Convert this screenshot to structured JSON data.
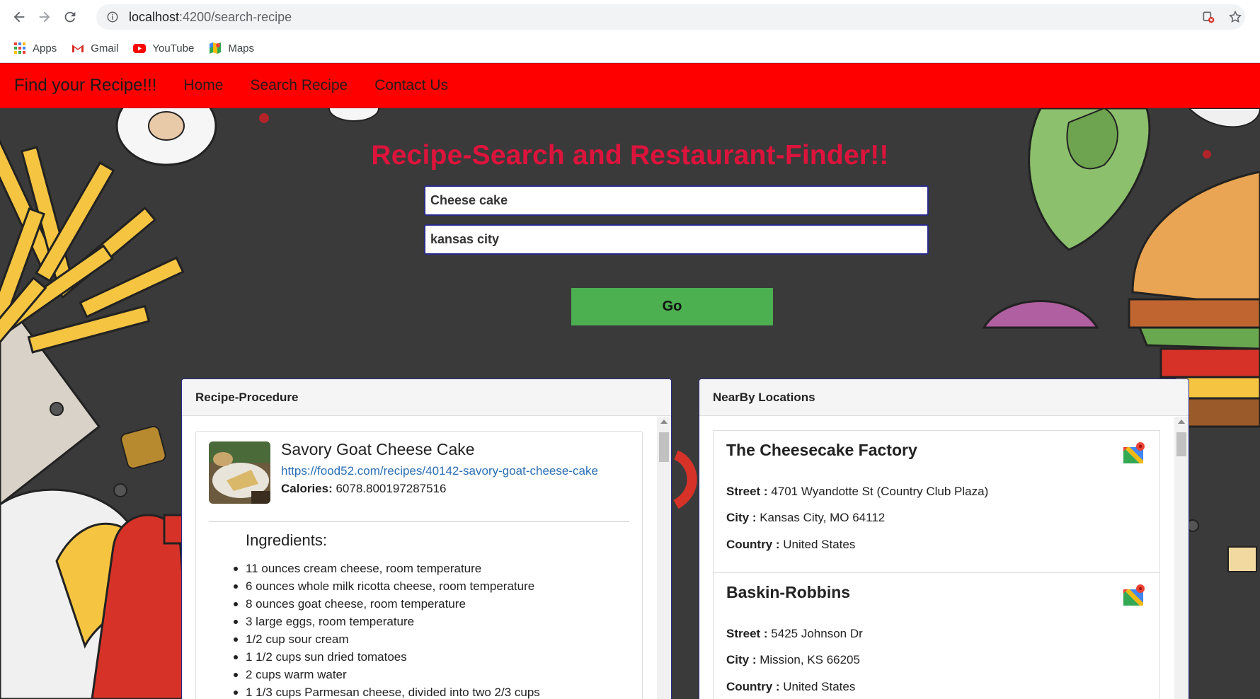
{
  "browser": {
    "url_host": "localhost",
    "url_path": ":4200/search-recipe",
    "bookmarks": [
      {
        "label": "Apps",
        "icon": "apps-grid-icon"
      },
      {
        "label": "Gmail",
        "icon": "gmail-icon"
      },
      {
        "label": "YouTube",
        "icon": "youtube-icon"
      },
      {
        "label": "Maps",
        "icon": "maps-icon"
      }
    ]
  },
  "app": {
    "brand": "Find your Recipe!!!",
    "nav": [
      "Home",
      "Search Recipe",
      "Contact Us"
    ],
    "title": "Recipe-Search and Restaurant-Finder!!",
    "recipe_query": "Cheese cake",
    "location_query": "kansas city",
    "go_label": "Go",
    "accent_color": "#ff0000",
    "title_color": "#dc143c",
    "button_color": "#4caf50"
  },
  "recipe_panel": {
    "header": "Recipe-Procedure",
    "recipe": {
      "title": "Savory Goat Cheese Cake",
      "link": "https://food52.com/recipes/40142-savory-goat-cheese-cake",
      "calories_label": "Calories:",
      "calories_value": " 6078.800197287516",
      "ingredients_heading": "Ingredients:",
      "ingredients": [
        "11 ounces cream cheese, room temperature",
        "6 ounces whole milk ricotta cheese, room temperature",
        "8 ounces goat cheese, room temperature",
        "3 large eggs, room temperature",
        "1/2 cup sour cream",
        "1 1/2 cups sun dried tomatoes",
        "2 cups warm water",
        "1 1/3 cups Parmesan cheese, divided into two 2/3 cups"
      ]
    }
  },
  "locations_panel": {
    "header": "NearBy Locations",
    "street_label": "Street :",
    "city_label": "City :",
    "country_label": "Country :",
    "locations": [
      {
        "name": "The Cheesecake Factory",
        "street": " 4701 Wyandotte St (Country Club Plaza)",
        "city": " Kansas City, MO 64112",
        "country": " United States"
      },
      {
        "name": "Baskin-Robbins",
        "street": " 5425 Johnson Dr",
        "city": " Mission, KS 66205",
        "country": " United States"
      }
    ]
  }
}
